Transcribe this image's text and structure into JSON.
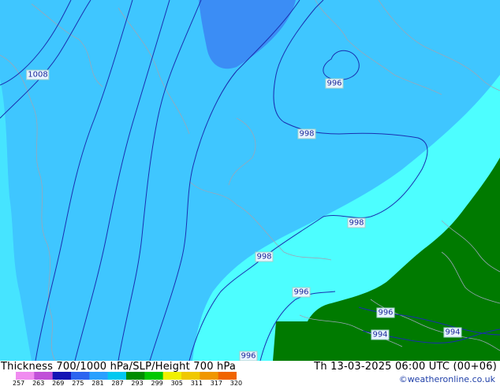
{
  "map": {
    "contour_labels": [
      "1008",
      "996",
      "998",
      "998",
      "998",
      "996",
      "996",
      "994",
      "994",
      "996"
    ]
  },
  "legend": {
    "title": "Thickness 700/1000 hPa/SLP/Height 700 hPa",
    "tick_labels": [
      "257",
      "263",
      "269",
      "275",
      "281",
      "287",
      "293",
      "299",
      "305",
      "311",
      "317",
      "320"
    ],
    "colors": [
      "#f08cf0",
      "#c050d8",
      "#1414b4",
      "#2c64f0",
      "#28a0ff",
      "#00c8f0",
      "#008c00",
      "#00c800",
      "#f0f000",
      "#f0c800",
      "#f09600",
      "#f06400"
    ]
  },
  "valid_time": "Th 13-03-2025 06:00 UTC (00+06)",
  "credit": "©weatheronline.co.uk",
  "palette": {
    "deep_blue": "#3b8df5",
    "mid_blue": "#3fc6ff",
    "cyan": "#4dfeff",
    "land_green": "#007a00",
    "isobar": "#1a2fb0",
    "coast": "#9aa6b8"
  }
}
